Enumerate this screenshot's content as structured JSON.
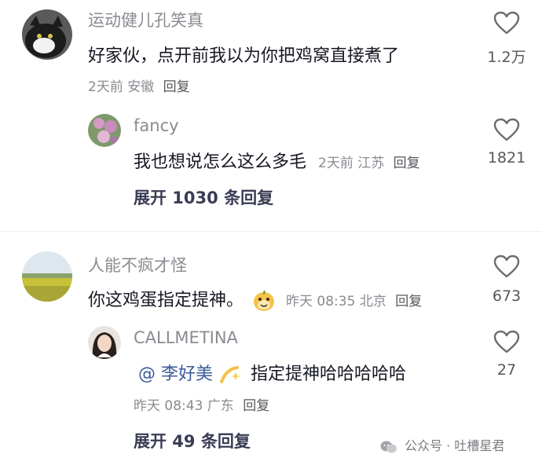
{
  "comments": [
    {
      "username": "运动健儿孔笑真",
      "text": "好家伙，点开前我以为你把鸡窝直接煮了",
      "time": "2天前",
      "location": "安徽",
      "reply_label": "回复",
      "likes": "1.2万",
      "replies": [
        {
          "username": "fancy",
          "text": "我也想说怎么这么多毛",
          "time": "2天前",
          "location": "江苏",
          "reply_label": "回复",
          "likes": "1821"
        }
      ],
      "expand_label": "展开 1030 条回复"
    },
    {
      "username": "人能不疯才怪",
      "text": "你这鸡蛋指定提神。",
      "emoji_icon": "smiling-face-sticker",
      "time": "昨天 08:35",
      "location": "北京",
      "reply_label": "回复",
      "likes": "673",
      "replies": [
        {
          "username": "CALLMETINA",
          "mention": "@ 李好美",
          "emoji_icon": "sparkle-emoji",
          "text": "指定提神哈哈哈哈哈",
          "time": "昨天 08:43",
          "location": "广东",
          "reply_label": "回复",
          "likes": "27"
        }
      ],
      "expand_label": "展开 49 条回复"
    }
  ],
  "watermark": "公众号 · 吐槽星君",
  "colors": {
    "text": "#161823",
    "muted": "#8a8b91",
    "expand": "#3a3c54"
  }
}
